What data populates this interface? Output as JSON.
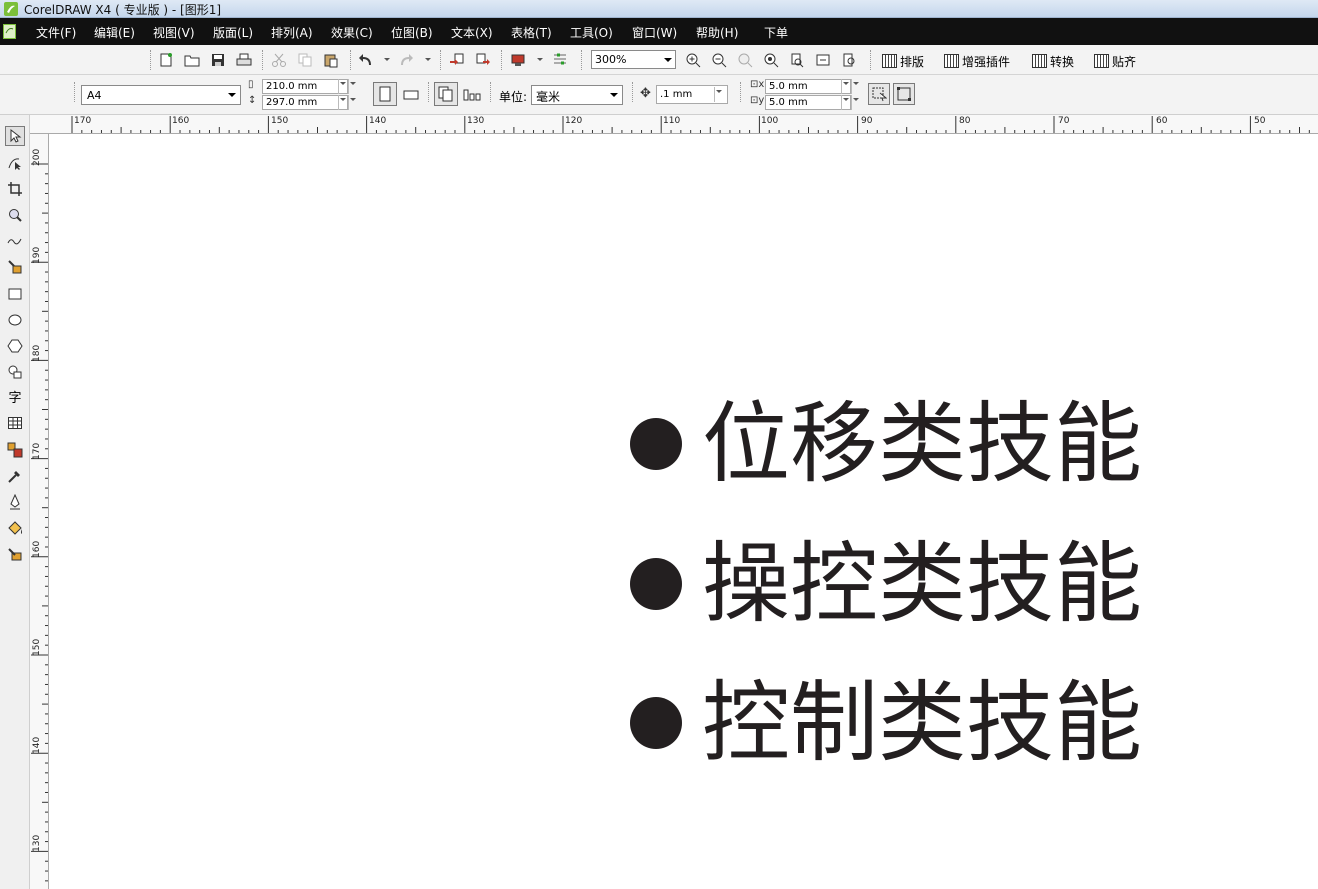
{
  "window": {
    "title": "CorelDRAW X4 ( 专业版 ) - [图形1]"
  },
  "menu": [
    {
      "label": "文件(F)"
    },
    {
      "label": "编辑(E)"
    },
    {
      "label": "视图(V)"
    },
    {
      "label": "版面(L)"
    },
    {
      "label": "排列(A)"
    },
    {
      "label": "效果(C)"
    },
    {
      "label": "位图(B)"
    },
    {
      "label": "文本(X)"
    },
    {
      "label": "表格(T)"
    },
    {
      "label": "工具(O)"
    },
    {
      "label": "窗口(W)"
    },
    {
      "label": "帮助(H)"
    },
    {
      "label": "下单"
    }
  ],
  "toolbar": {
    "zoom_value": "300%",
    "plugins": [
      {
        "label": "排版",
        "icon": "layout-plugin-icon"
      },
      {
        "label": "增强插件",
        "icon": "enhance-plugin-icon"
      },
      {
        "label": "转换",
        "icon": "convert-plugin-icon"
      },
      {
        "label": "贴齐",
        "icon": "snap-plugin-icon"
      }
    ]
  },
  "property_bar": {
    "page_size": "A4",
    "page_width": "210.0 mm",
    "page_height": "297.0 mm",
    "unit_label": "单位:",
    "unit_value": "毫米",
    "nudge_value": ".1 mm",
    "dup_x": "5.0 mm",
    "dup_y": "5.0 mm"
  },
  "toolbox": [
    {
      "icon": "pick-tool-icon",
      "active": true
    },
    {
      "icon": "shape-tool-icon"
    },
    {
      "icon": "crop-tool-icon"
    },
    {
      "icon": "zoom-tool-icon"
    },
    {
      "icon": "freehand-tool-icon"
    },
    {
      "icon": "smart-fill-tool-icon"
    },
    {
      "icon": "rectangle-tool-icon"
    },
    {
      "icon": "ellipse-tool-icon"
    },
    {
      "icon": "polygon-tool-icon"
    },
    {
      "icon": "basic-shapes-tool-icon"
    },
    {
      "icon": "text-tool-icon",
      "glyph": "字"
    },
    {
      "icon": "table-tool-icon"
    },
    {
      "icon": "interactive-blend-tool-icon"
    },
    {
      "icon": "eyedropper-tool-icon"
    },
    {
      "icon": "outline-tool-icon"
    },
    {
      "icon": "fill-tool-icon"
    },
    {
      "icon": "interactive-fill-tool-icon"
    }
  ],
  "rulers": {
    "horizontal": [
      "170",
      "160",
      "150",
      "140",
      "130",
      "120",
      "110",
      "100",
      "90",
      "80",
      "70",
      "60",
      "50"
    ],
    "vertical": [
      "200",
      "190",
      "180",
      "170",
      "160",
      "150",
      "140",
      "130"
    ]
  },
  "canvas": {
    "bullet_color": "#231f20",
    "lines": [
      {
        "text": "位移类技能"
      },
      {
        "text": "操控类技能"
      },
      {
        "text": "控制类技能"
      }
    ]
  }
}
